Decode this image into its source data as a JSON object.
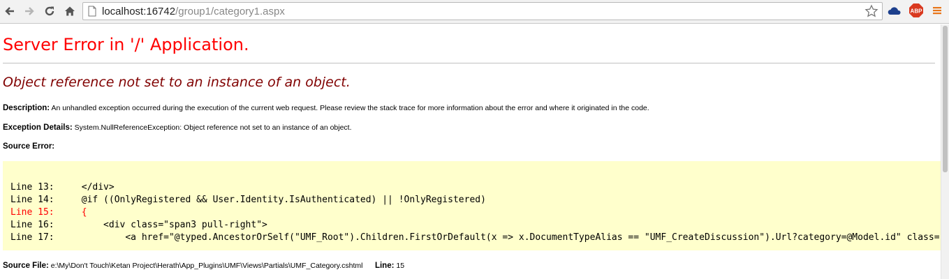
{
  "browser": {
    "url_host": "localhost:16742",
    "url_path": "/group1/category1.aspx",
    "abp_label": "ABP"
  },
  "page": {
    "title": "Server Error in '/' Application.",
    "error_message": "Object reference not set to an instance of an object.",
    "description_label": "Description:",
    "description_text": "An unhandled exception occurred during the execution of the current web request. Please review the stack trace for more information about the error and where it originated in the code.",
    "exception_label": "Exception Details:",
    "exception_text": "System.NullReferenceException: Object reference not set to an instance of an object.",
    "source_error_label": "Source Error:",
    "source_lines": [
      "Line 13:     </div>",
      "Line 14:     @if ((OnlyRegistered && User.Identity.IsAuthenticated) || !OnlyRegistered)",
      "Line 15:     {",
      "Line 16:         <div class=\"span3 pull-right\">",
      "Line 17:             <a href=\"@typed.AncestorOrSelf(\"UMF_Root\").Children.FirstOrDefault(x => x.DocumentTypeAlias == \"UMF_CreateDiscussion\").Url?category=@Model.id\" class="
    ],
    "source_file_label": "Source File:",
    "source_file_path": "e:\\My\\Don't Touch\\Ketan Project\\Herath\\App_Plugins\\UMF\\Views\\Partials\\UMF_Category.cshtml",
    "line_label": "Line:",
    "line_number": "15"
  },
  "colors": {
    "title": "#ff0000",
    "error_message": "#800000",
    "code_background": "#ffffcc",
    "highlight_line": "#ff0000"
  }
}
